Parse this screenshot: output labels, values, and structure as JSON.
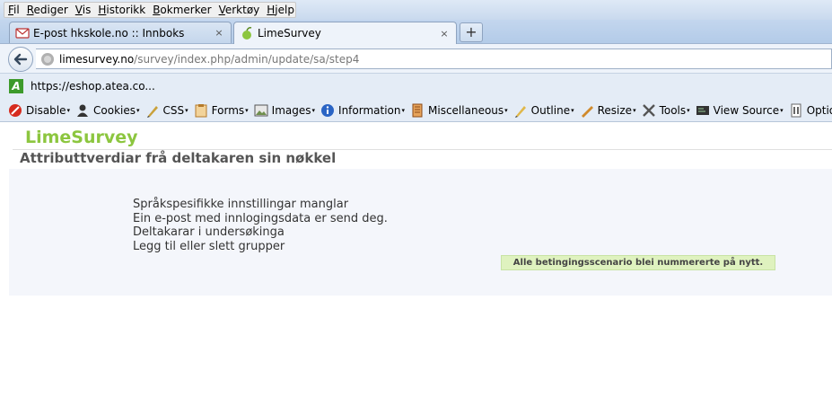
{
  "menubar": {
    "items": [
      "Fil",
      "Rediger",
      "Vis",
      "Historikk",
      "Bokmerker",
      "Verktøy",
      "Hjelp"
    ]
  },
  "tabs": [
    {
      "label": "E-post hkskole.no :: Innboks",
      "icon": "mail-icon",
      "active": false
    },
    {
      "label": "LimeSurvey",
      "icon": "limesurvey-icon",
      "active": true
    }
  ],
  "newtab_label": "+",
  "tab_close_glyph": "×",
  "nav": {
    "back_glyph": "🡐",
    "url_host": "limesurvey.no",
    "url_path": "/survey/index.php/admin/update/sa/step4"
  },
  "bookmarks": {
    "items": [
      {
        "label": "https://eshop.atea.co...",
        "icon": "atea-icon"
      }
    ]
  },
  "devtoolbar": {
    "items": [
      {
        "label": "Disable",
        "icon": "disable-icon",
        "color": "#d62b1e"
      },
      {
        "label": "Cookies",
        "icon": "cookies-icon",
        "color": "#333333"
      },
      {
        "label": "CSS",
        "icon": "css-icon",
        "color": "#c9a13b"
      },
      {
        "label": "Forms",
        "icon": "forms-icon",
        "color": "#c4883a"
      },
      {
        "label": "Images",
        "icon": "images-icon",
        "color": "#6f8f4e"
      },
      {
        "label": "Information",
        "icon": "information-icon",
        "color": "#2a64c4"
      },
      {
        "label": "Miscellaneous",
        "icon": "miscellaneous-icon",
        "color": "#c06a2b"
      },
      {
        "label": "Outline",
        "icon": "outline-icon",
        "color": "#c9a13b"
      },
      {
        "label": "Resize",
        "icon": "resize-icon",
        "color": "#d08a2c"
      },
      {
        "label": "Tools",
        "icon": "tools-icon",
        "color": "#555555"
      },
      {
        "label": "View Source",
        "icon": "view-source-icon",
        "color": "#333333"
      },
      {
        "label": "Options",
        "icon": "options-icon",
        "color": "#666666"
      }
    ]
  },
  "page": {
    "logo": "LimeSurvey",
    "title": "Attributtverdiar frå deltakaren sin nøkkel",
    "messages": [
      "Språkspesifikke innstillingar manglar",
      "Ein e-post med innlogingsdata er send deg.",
      "Deltakarar i undersøkinga",
      "Legg til eller slett grupper"
    ],
    "notice": "Alle betingingsscenario blei nummererte på nytt."
  },
  "colors": {
    "logo": "#8cc63f",
    "notice_bg": "#dff2bf",
    "content_bg": "#f4f6fb"
  }
}
